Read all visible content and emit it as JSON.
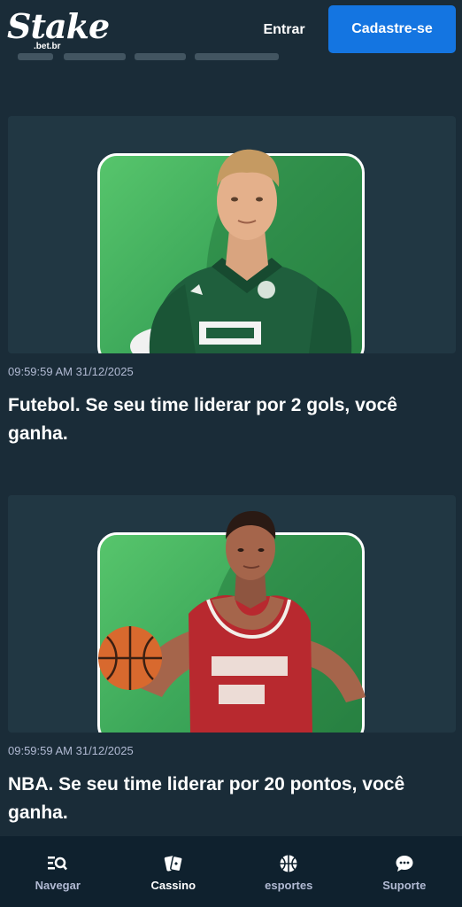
{
  "header": {
    "logo_text": "Stake",
    "logo_sub": ".bet.br",
    "login_label": "Entrar",
    "register_label": "Cadastre-se"
  },
  "feed": {
    "items": [
      {
        "timestamp": "09:59:59 AM 31/12/2025",
        "headline": "Futebol. Se seu time liderar por 2 gols, você ganha."
      },
      {
        "timestamp": "09:59:59 AM 31/12/2025",
        "headline": "NBA. Se seu time liderar por 20 pontos, você ganha."
      }
    ]
  },
  "bottom_nav": {
    "items": [
      {
        "label": "Navegar",
        "icon": "browse-icon"
      },
      {
        "label": "Cassino",
        "icon": "cards-icon"
      },
      {
        "label": "esportes",
        "icon": "basketball-icon"
      },
      {
        "label": "Suporte",
        "icon": "chat-icon"
      }
    ]
  },
  "colors": {
    "background": "#1a2c38",
    "card": "#213743",
    "accent_blue": "#1475e1",
    "promo_green": "#4cb863",
    "nav_bg": "#0f212e"
  }
}
